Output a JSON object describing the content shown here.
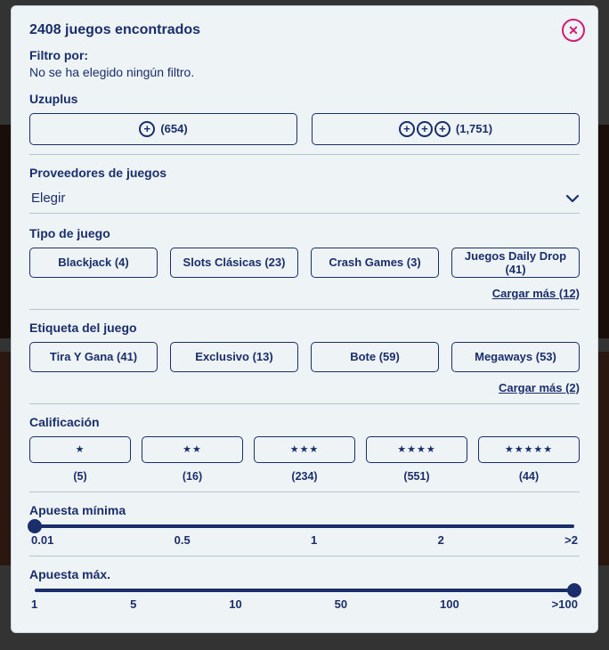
{
  "header": {
    "results_label": "2408 juegos encontrados",
    "filter_label": "Filtro por:",
    "filter_status": "No se ha elegido ningún filtro."
  },
  "uzuplus": {
    "heading": "Uzuplus",
    "option_single_count": "(654)",
    "option_multi_count": "(1,751)"
  },
  "providers": {
    "heading": "Proveedores de juegos",
    "select_placeholder": "Elegir"
  },
  "game_type": {
    "heading": "Tipo de juego",
    "chips": [
      "Blackjack (4)",
      "Slots Clásicas (23)",
      "Crash Games (3)",
      "Juegos Daily Drop (41)"
    ],
    "load_more": "Cargar más (12)"
  },
  "game_tag": {
    "heading": "Etiqueta del juego",
    "chips": [
      "Tira Y Gana (41)",
      "Exclusivo (13)",
      "Bote (59)",
      "Megaways (53)"
    ],
    "load_more": "Cargar más (2)"
  },
  "rating": {
    "heading": "Calificación",
    "levels": [
      {
        "stars": 1,
        "count": "(5)"
      },
      {
        "stars": 2,
        "count": "(16)"
      },
      {
        "stars": 3,
        "count": "(234)"
      },
      {
        "stars": 4,
        "count": "(551)"
      },
      {
        "stars": 5,
        "count": "(44)"
      }
    ]
  },
  "min_bet": {
    "heading": "Apuesta mínima",
    "labels": [
      "0.01",
      "0.5",
      "1",
      "2",
      ">2"
    ],
    "thumb_pct": 0
  },
  "max_bet": {
    "heading": "Apuesta máx.",
    "labels": [
      "1",
      "5",
      "10",
      "50",
      "100",
      ">100"
    ],
    "thumb_pct": 100
  }
}
